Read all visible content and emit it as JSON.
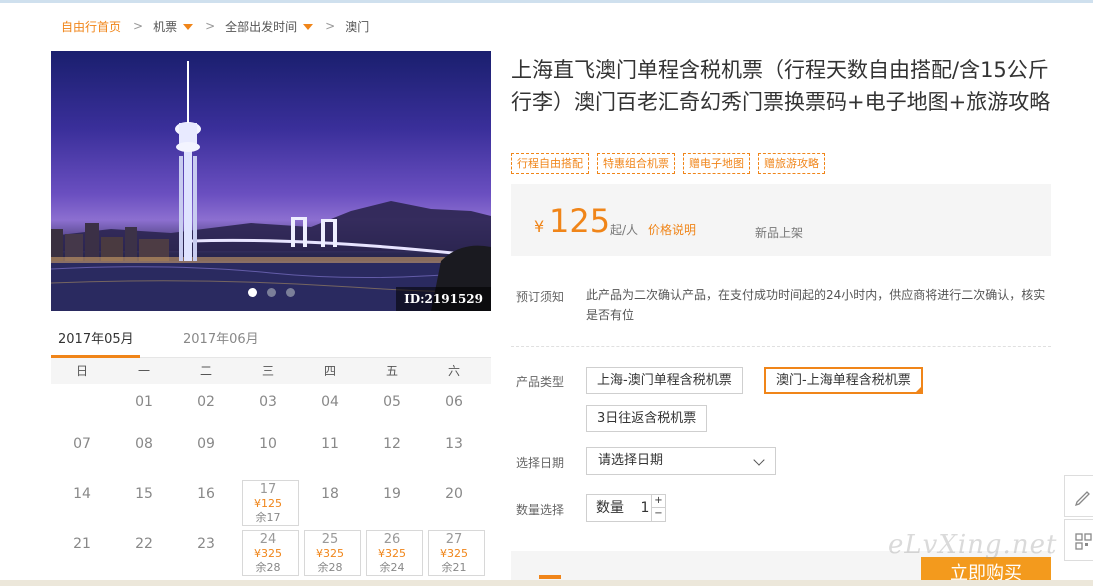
{
  "breadcrumb": {
    "home": "自由行首页",
    "item1": "机票",
    "item2": "全部出发时间",
    "item3": "澳门"
  },
  "hero": {
    "id_tag": "ID:2191529",
    "slide_count": 3,
    "active_slide": 1
  },
  "product": {
    "title": "上海直飞澳门单程含税机票（行程天数自由搭配/含15公斤行李）澳门百老汇奇幻秀门票换票码+电子地图+旅游攻略",
    "tags": [
      "行程自由搭配",
      "特惠组合机票",
      "赠电子地图",
      "赠旅游攻略"
    ]
  },
  "price": {
    "currency": "¥",
    "amount": "125",
    "unit": "起/人",
    "explain_link": "价格说明",
    "badge": "新品上架"
  },
  "notice": {
    "label": "预订须知",
    "text": "此产品为二次确认产品，在支付成功时间起的24小时内，供应商将进行二次确认，核实是否有位"
  },
  "product_type": {
    "label": "产品类型",
    "options": [
      "上海-澳门单程含税机票",
      "澳门-上海单程含税机票",
      "3日往返含税机票"
    ],
    "selected_index": 1
  },
  "date": {
    "label": "选择日期",
    "placeholder": "请选择日期"
  },
  "quantity": {
    "label": "数量选择",
    "field_label": "数量",
    "value": "1",
    "plus": "+",
    "minus": "−"
  },
  "buy": {
    "button": "立即购买"
  },
  "watermark": "eLvXing.net",
  "calendar": {
    "month_tabs": [
      "2017年05月",
      "2017年06月"
    ],
    "active_month": 0,
    "weekdays": [
      "日",
      "一",
      "二",
      "三",
      "四",
      "五",
      "六"
    ],
    "rows": [
      [
        {
          "d": ""
        },
        {
          "d": "01"
        },
        {
          "d": "02"
        },
        {
          "d": "03"
        },
        {
          "d": "04"
        },
        {
          "d": "05"
        },
        {
          "d": "06"
        }
      ],
      [
        {
          "d": "07"
        },
        {
          "d": "08"
        },
        {
          "d": "09"
        },
        {
          "d": "10"
        },
        {
          "d": "11"
        },
        {
          "d": "12"
        },
        {
          "d": "13"
        }
      ],
      [
        {
          "d": "14"
        },
        {
          "d": "15"
        },
        {
          "d": "16"
        },
        {
          "d": "17",
          "p": "¥125",
          "s": "余17"
        },
        {
          "d": "18"
        },
        {
          "d": "19"
        },
        {
          "d": "20"
        }
      ],
      [
        {
          "d": "21"
        },
        {
          "d": "22"
        },
        {
          "d": "23"
        },
        {
          "d": "24",
          "p": "¥325",
          "s": "余28"
        },
        {
          "d": "25",
          "p": "¥325",
          "s": "余28"
        },
        {
          "d": "26",
          "p": "¥325",
          "s": "余24"
        },
        {
          "d": "27",
          "p": "¥325",
          "s": "余21"
        }
      ]
    ]
  },
  "colors": {
    "accent": "#f08519",
    "button": "#f39a1d"
  }
}
